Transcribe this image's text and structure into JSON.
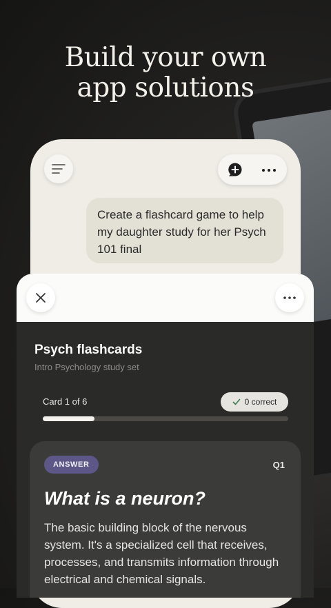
{
  "headline": {
    "line1": "Build your own",
    "line2": "app solutions"
  },
  "chat": {
    "prompt": "Create a flashcard game to help my daughter study for her Psych 101 final"
  },
  "flashcards": {
    "title": "Psych flashcards",
    "subtitle": "Intro Psychology study set",
    "card_counter": "Card 1 of 6",
    "correct_badge": "0 correct",
    "progress": 0.21,
    "card": {
      "tag": "ANSWER",
      "number": "Q1",
      "question": "What is a neuron?",
      "answer": "The basic building block of the nervous system. It's a specialized cell that receives, processes, and transmits information through electrical and chemical signals."
    }
  },
  "icons": {
    "menu": "menu-icon",
    "new_chat": "new-chat-icon",
    "more": "more-horizontal-icon",
    "close": "close-icon",
    "check": "check-icon"
  },
  "colors": {
    "background": "#1a1a19",
    "phone_surface": "#efede6",
    "sheet": "#2a2a29",
    "card": "#3b3b39",
    "answer_tag": "#5c5786"
  }
}
